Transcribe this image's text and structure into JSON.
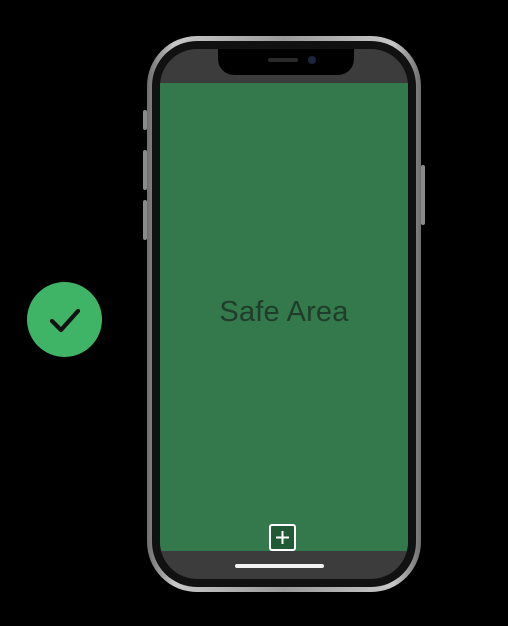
{
  "safe_area": {
    "label": "Safe Area"
  },
  "icons": {
    "check": "check-icon",
    "plus": "plus-icon"
  },
  "colors": {
    "background": "#000000",
    "safe_area": "#33794b",
    "badge": "#3fb466",
    "label": "#1f3d2a",
    "home_indicator": "#f2f2f2"
  }
}
